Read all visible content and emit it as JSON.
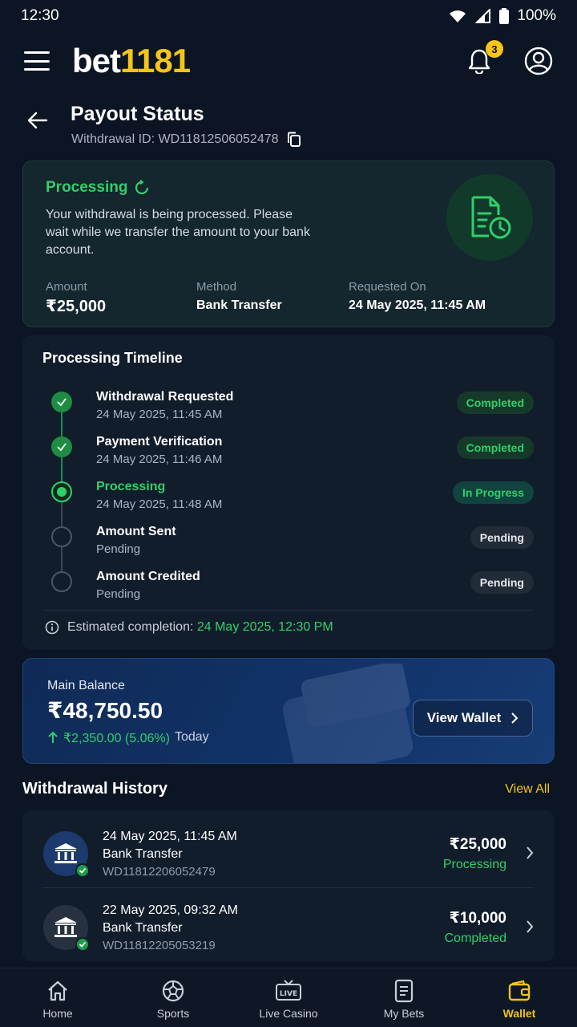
{
  "status_bar": {
    "time": "12:30",
    "battery": "100%"
  },
  "header": {
    "logo_white": "bet",
    "logo_yellow": "1181",
    "notification_count": "3"
  },
  "page": {
    "title": "Payout Status",
    "withdrawal_id": "Withdrawal ID: WD11812506052478"
  },
  "status_card": {
    "status": "Processing",
    "description": "Your withdrawal is being processed. Please wait while we transfer the amount to your bank account.",
    "amount_label": "Amount",
    "amount": "₹25,000",
    "method_label": "Method",
    "method": "Bank Transfer",
    "requested_label": "Requested On",
    "requested": "24 May 2025, 11:45 AM"
  },
  "timeline": {
    "title": "Processing Timeline",
    "steps": [
      {
        "name": "Withdrawal Requested",
        "time": "24 May 2025, 11:45 AM",
        "status": "Completed"
      },
      {
        "name": "Payment Verification",
        "time": "24 May 2025, 11:46 AM",
        "status": "Completed"
      },
      {
        "name": "Processing",
        "time": "24 May 2025, 11:48 AM",
        "status": "In Progress"
      },
      {
        "name": "Amount Sent",
        "time": "Pending",
        "status": "Pending"
      },
      {
        "name": "Amount Credited",
        "time": "Pending",
        "status": "Pending"
      }
    ],
    "estimate_label": "Estimated completion:",
    "estimate_value": "24 May 2025, 12:30 PM"
  },
  "balance": {
    "label": "Main Balance",
    "amount": "₹48,750.50",
    "change": "₹2,350.00 (5.06%)",
    "change_suffix": "Today",
    "button": "View Wallet"
  },
  "history": {
    "title": "Withdrawal History",
    "view_all": "View All",
    "items": [
      {
        "date": "24 May 2025, 11:45 AM",
        "method": "Bank Transfer",
        "id": "WD11812206052479",
        "amount": "₹25,000",
        "status": "Processing"
      },
      {
        "date": "22 May 2025, 09:32 AM",
        "method": "Bank Transfer",
        "id": "WD11812205053219",
        "amount": "₹10,000",
        "status": "Completed"
      }
    ]
  },
  "nav": {
    "items": [
      {
        "label": "Home"
      },
      {
        "label": "Sports"
      },
      {
        "label": "Live Casino"
      },
      {
        "label": "My Bets"
      },
      {
        "label": "Wallet"
      }
    ],
    "live_badge": "LIVE"
  },
  "colors": {
    "accent": "#f5c518",
    "success": "#2fd06a",
    "background": "#0b1524",
    "card": "#121d2c"
  }
}
